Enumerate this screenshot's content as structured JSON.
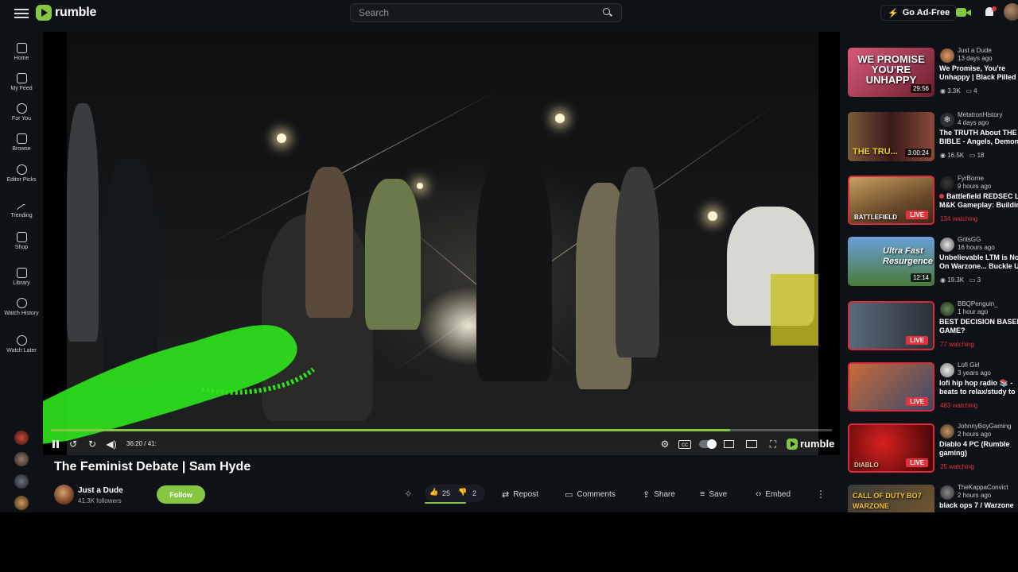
{
  "header": {
    "logo_text": "rumble",
    "search_placeholder": "Search",
    "ad_free_label": "Go Ad-Free"
  },
  "sidebar": {
    "items": [
      {
        "label": "Home"
      },
      {
        "label": "My Feed"
      },
      {
        "label": "For You"
      },
      {
        "label": "Browse"
      },
      {
        "label": "Editor Picks"
      },
      {
        "label": "Trending"
      },
      {
        "label": "Shop"
      },
      {
        "label": "Library"
      },
      {
        "label": "Watch History"
      },
      {
        "label": "Watch Later"
      }
    ]
  },
  "player": {
    "time": "36:20 / 41:",
    "progress_fraction": 0.87,
    "logo_text": "rumble"
  },
  "video": {
    "title": "The Feminist Debate | Sam Hyde",
    "channel": "Just a Dude",
    "followers": "41.3K followers",
    "follow_label": "Follow",
    "likes": "25",
    "dislikes": "2",
    "repost_label": "Repost",
    "comments_label": "Comments",
    "share_label": "Share",
    "save_label": "Save",
    "embed_label": "Embed"
  },
  "recommended": [
    {
      "thumb_text": "WE PROMISE YOU'RE UNHAPPY",
      "duration": "29:56",
      "channel": "Just a Dude",
      "ago": "13 days ago",
      "title1": "We Promise, You're",
      "title2": "Unhappy | Black Pilled",
      "views": "3.3K",
      "comments": "4",
      "live": false
    },
    {
      "thumb_text": "THE TRU...",
      "duration": "3:00:24",
      "channel": "MetatronHistory",
      "ago": "4 days ago",
      "title1": "The TRUTH About THE",
      "title2": "BIBLE - Angels, Demons",
      "views": "16.5K",
      "comments": "18",
      "live": false
    },
    {
      "thumb_text": "BATTLEFIELD",
      "channel": "FyrBorne",
      "ago": "9 hours ago",
      "title1": "Battlefield REDSEC L",
      "title2": "M&K Gameplay: Building",
      "watching": "134 watching",
      "live": true
    },
    {
      "thumb_text": "Ultra Fast Resurgence",
      "duration": "12:14",
      "channel": "GritsGG",
      "ago": "16 hours ago",
      "title1": "Unbelievable LTM is No",
      "title2": "On Warzone... Buckle U",
      "views": "19.3K",
      "comments": "3",
      "live": false
    },
    {
      "thumb_text": "",
      "channel": "BBQPenguin_",
      "ago": "1 hour ago",
      "title1": "BEST DECISION BASED",
      "title2": "GAME?",
      "watching": "77 watching",
      "live": true
    },
    {
      "thumb_text": "",
      "channel": "Lofi Girl",
      "ago": "3 years ago",
      "title1": "lofi hip hop radio 📚 -",
      "title2": "beats to relax/study to",
      "watching": "483 watching",
      "live": true
    },
    {
      "thumb_text": "DIABLO",
      "channel": "JohnnyBoyGaming",
      "ago": "2 hours ago",
      "title1": "Diablo 4 PC (Rumble",
      "title2": "gaming)",
      "watching": "25 watching",
      "live": true
    },
    {
      "thumb_text": "CALL OF DUTY BO7 WARZONE",
      "channel": "TheKappaConvict",
      "ago": "2 hours ago",
      "title1": "black ops 7 / Warzone",
      "title2": "",
      "live": false
    }
  ],
  "colors": {
    "brand": "#85c742",
    "live": "#e3323c",
    "background": "#0e1115"
  }
}
